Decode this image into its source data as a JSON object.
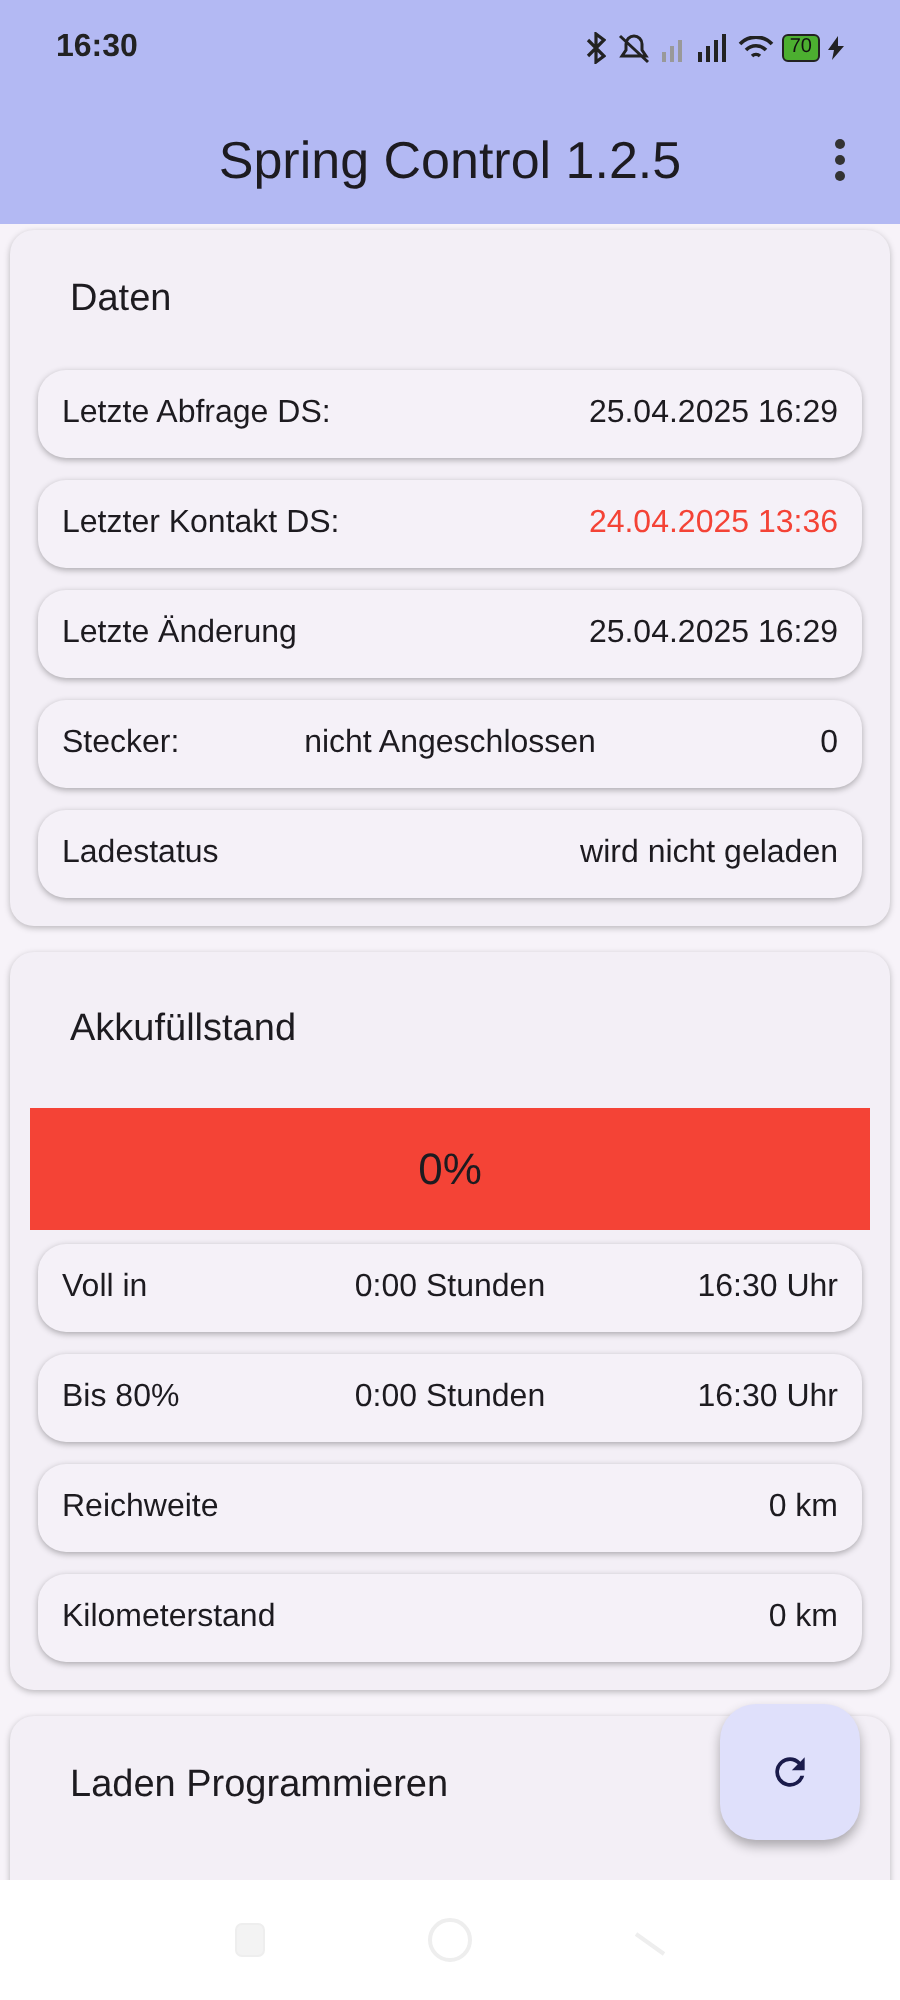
{
  "status_bar": {
    "time": "16:30",
    "battery": "70"
  },
  "app_bar": {
    "title": "Spring Control 1.2.5"
  },
  "sections": [
    {
      "title": "Daten",
      "rows": [
        {
          "label": "Letzte Abfrage DS:",
          "value": "25.04.2025 16:29",
          "warning": false
        },
        {
          "label": "Letzter Kontakt DS:",
          "value": "24.04.2025 13:36",
          "warning": true
        },
        {
          "label": "Letzte Änderung",
          "value": "25.04.2025 16:29",
          "warning": false
        },
        {
          "label": "Stecker:",
          "middle": "nicht Angeschlossen",
          "value": "0",
          "warning": false
        },
        {
          "label": "Ladestatus",
          "value": "wird nicht geladen",
          "warning": false
        }
      ]
    },
    {
      "title": "Akkufüllstand",
      "banner": "0%",
      "rows": [
        {
          "label": "Voll in",
          "middle": "0:00 Stunden",
          "value": "16:30 Uhr",
          "warning": false
        },
        {
          "label": "Bis 80%",
          "middle": "0:00 Stunden",
          "value": "16:30 Uhr",
          "warning": false
        },
        {
          "label": "Reichweite",
          "value": "0 km",
          "warning": false
        },
        {
          "label": "Kilometerstand",
          "value": "0 km",
          "warning": false
        }
      ]
    },
    {
      "title": "Laden Programmieren"
    }
  ]
}
